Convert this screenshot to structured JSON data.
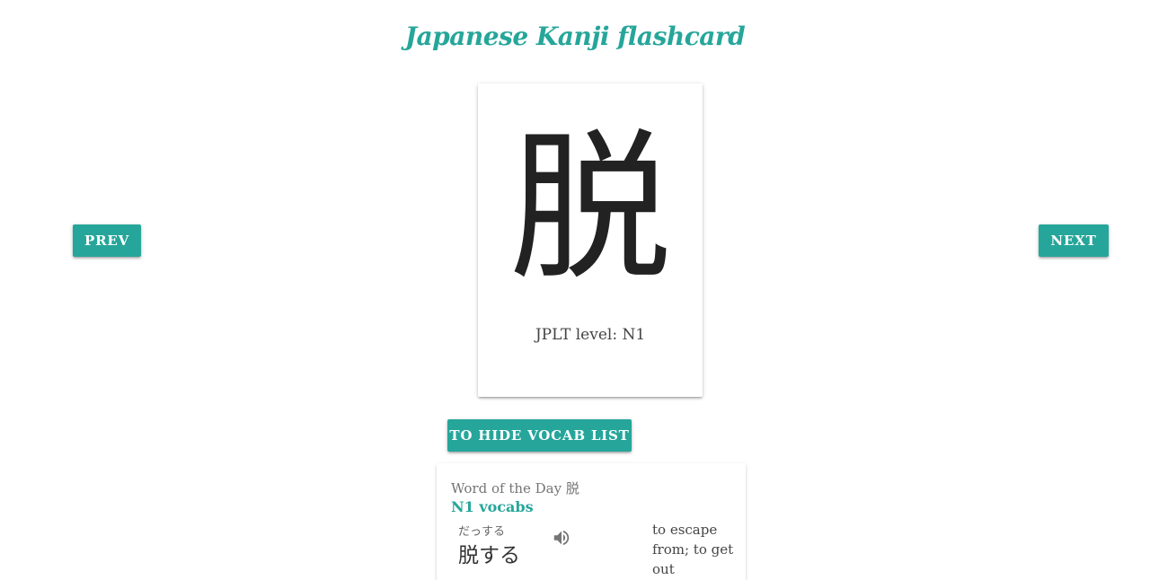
{
  "header": {
    "title": "Japanese Kanji flashcard"
  },
  "nav": {
    "prev_label": "PREV",
    "next_label": "NEXT"
  },
  "flashcard": {
    "kanji": "脱",
    "jlpt_label": "JPLT level: N1"
  },
  "vocab_toggle": {
    "label": "TO HIDE VOCAB LIST"
  },
  "vocab": {
    "heading": "Word of the Day 脱",
    "level_link": "N1 vocabs",
    "items": [
      {
        "reading": "だっする",
        "word": "脱する",
        "meaning": "to escape from; to get out",
        "icon": "speaker-icon"
      }
    ]
  },
  "colors": {
    "accent": "#26a69a",
    "text": "#333333",
    "muted": "#757575"
  }
}
